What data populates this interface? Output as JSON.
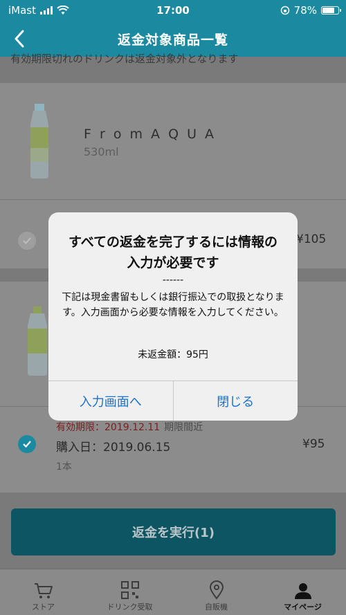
{
  "status_bar": {
    "carrier": "iMast",
    "time": "17:00",
    "battery": "78%",
    "battery_level": 0.78
  },
  "header": {
    "title": "返金対象商品一覧"
  },
  "notice": "有効期限切れのドリンクは返金対象外となります",
  "products": [
    {
      "name": "F r o m A Q U A",
      "size": "530ml",
      "price": "¥105",
      "checked": false
    },
    {
      "expiry_label": "有効期限：2019.12.11",
      "expiry_note": "期限間近",
      "purchase": "購入日：2019.06.15",
      "quantity": "1本",
      "price": "¥95",
      "checked": true
    }
  ],
  "execute_button": "返金を実行(1)",
  "tabs": [
    {
      "label": "ストア",
      "icon": "cart-icon"
    },
    {
      "label": "ドリンク受取",
      "icon": "qr-code-icon"
    },
    {
      "label": "自販機",
      "icon": "location-pin-icon"
    },
    {
      "label": "マイページ",
      "icon": "person-icon",
      "active": true
    }
  ],
  "dialog": {
    "title": "すべての返金を完了するには情報の入力が必要です",
    "separator": "------",
    "message": "下記は現金書留もしくは銀行振込での取扱となります。入力画面から必要な情報を入力してください。",
    "amount": "未返金額：95円",
    "primary_action": "入力画面へ",
    "secondary_action": "閉じる"
  },
  "colors": {
    "brand": "#1b8aa0",
    "link": "#1a72c9",
    "expiry": "#d93a3a"
  }
}
